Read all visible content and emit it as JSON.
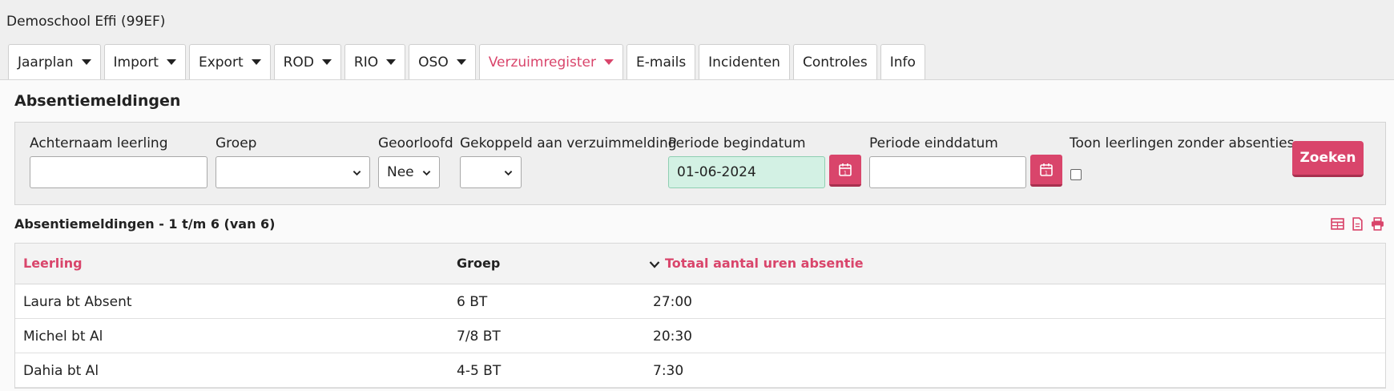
{
  "header": {
    "school": "Demoschool Effi (99EF)"
  },
  "tabs": [
    {
      "label": "Jaarplan",
      "dropdown": true,
      "active": false
    },
    {
      "label": "Import",
      "dropdown": true,
      "active": false
    },
    {
      "label": "Export",
      "dropdown": true,
      "active": false
    },
    {
      "label": "ROD",
      "dropdown": true,
      "active": false
    },
    {
      "label": "RIO",
      "dropdown": true,
      "active": false
    },
    {
      "label": "OSO",
      "dropdown": true,
      "active": false
    },
    {
      "label": "Verzuimregister",
      "dropdown": true,
      "active": true
    },
    {
      "label": "E-mails",
      "dropdown": false,
      "active": false
    },
    {
      "label": "Incidenten",
      "dropdown": false,
      "active": false
    },
    {
      "label": "Controles",
      "dropdown": false,
      "active": false
    },
    {
      "label": "Info",
      "dropdown": false,
      "active": false
    }
  ],
  "section": {
    "title": "Absentiemeldingen"
  },
  "filters": {
    "surname_label": "Achternaam leerling",
    "surname_value": "",
    "group_label": "Groep",
    "group_value": "",
    "authorized_label": "Geoorloofd",
    "authorized_value": "Nee",
    "linked_label": "Gekoppeld aan verzuimmelding",
    "linked_value": "",
    "start_label": "Periode begindatum",
    "start_value": "01-06-2024",
    "end_label": "Periode einddatum",
    "end_value": "",
    "show_without_label": "Toon leerlingen zonder absenties",
    "search_label": "Zoeken"
  },
  "results": {
    "title": "Absentiemeldingen - 1 t/m 6 (van 6)",
    "tools": [
      "table-icon",
      "document-icon",
      "print-icon"
    ],
    "columns": [
      "Leerling",
      "Groep",
      "Totaal aantal uren absentie"
    ],
    "rows": [
      {
        "student": "Laura bt Absent",
        "group": "6 BT",
        "hours": "27:00"
      },
      {
        "student": "Michel bt Al",
        "group": "7/8 BT",
        "hours": "20:30"
      },
      {
        "student": "Dahia bt Al",
        "group": "4-5 BT",
        "hours": "7:30"
      }
    ]
  },
  "colors": {
    "accent": "#d9456b",
    "highlight": "#d3f1e4",
    "background": "#efefef"
  }
}
